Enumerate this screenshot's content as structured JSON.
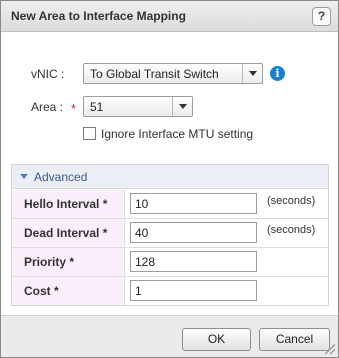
{
  "dialog": {
    "title": "New Area to Interface Mapping",
    "help_label": "?"
  },
  "vnic": {
    "label": "vNIC :",
    "selected": "To Global Transit Switch",
    "info_icon": "info-icon",
    "info_glyph": "i"
  },
  "area": {
    "label": "Area :",
    "required_marker": "*",
    "selected": "51"
  },
  "ignore_mtu": {
    "label": "Ignore Interface MTU setting",
    "checked": false
  },
  "advanced": {
    "title": "Advanced",
    "fields": [
      {
        "label": "Hello Interval *",
        "value": "10",
        "unit": "(seconds)"
      },
      {
        "label": "Dead Interval *",
        "value": "40",
        "unit": "(seconds)"
      },
      {
        "label": "Priority *",
        "value": "128",
        "unit": ""
      },
      {
        "label": "Cost *",
        "value": "1",
        "unit": ""
      }
    ]
  },
  "footer": {
    "ok_label": "OK",
    "cancel_label": "Cancel"
  },
  "colors": {
    "required": "#d9232e",
    "info": "#1b7fd1",
    "label_cell_bg": "#fbeefb"
  }
}
